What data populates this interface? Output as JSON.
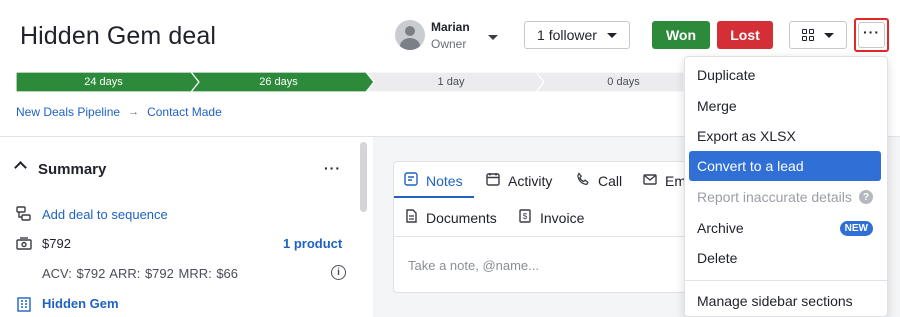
{
  "deal": {
    "title": "Hidden Gem deal"
  },
  "owner": {
    "name": "Marian",
    "role": "Owner"
  },
  "header_buttons": {
    "follower": "1 follower",
    "won": "Won",
    "lost": "Lost",
    "more": "···"
  },
  "stages": [
    {
      "label": "24 days",
      "status": "done"
    },
    {
      "label": "26 days",
      "status": "done"
    },
    {
      "label": "1 day",
      "status": "todo"
    },
    {
      "label": "0 days",
      "status": "todo"
    }
  ],
  "breadcrumb": {
    "pipeline": "New Deals Pipeline",
    "arrow": "→",
    "stage": "Contact Made"
  },
  "summary": {
    "title": "Summary",
    "more": "···",
    "add_sequence": "Add deal to sequence",
    "amount": "$792",
    "products": "1 product",
    "metrics": "ACV: $792  ARR: $792  MRR: $66",
    "organization": "Hidden Gem"
  },
  "notes_panel": {
    "tabs": {
      "notes": "Notes",
      "activity": "Activity",
      "call": "Call",
      "email": "Em",
      "documents": "Documents",
      "invoice": "Invoice"
    },
    "placeholder": "Take a note, @name..."
  },
  "more_menu": {
    "items": [
      {
        "label": "Duplicate"
      },
      {
        "label": "Merge"
      },
      {
        "label": "Export as XLSX"
      },
      {
        "label": "Convert to a lead"
      },
      {
        "label": "Report inaccurate details"
      },
      {
        "label": "Archive",
        "badge": "NEW"
      },
      {
        "label": "Delete"
      },
      {
        "label": "Manage sidebar sections"
      }
    ]
  },
  "colors": {
    "won": "#2d8a3a",
    "lost": "#d42f36",
    "link": "#1f62c4",
    "active_menu": "#2f6fd6",
    "highlight_border": "#e02828"
  }
}
